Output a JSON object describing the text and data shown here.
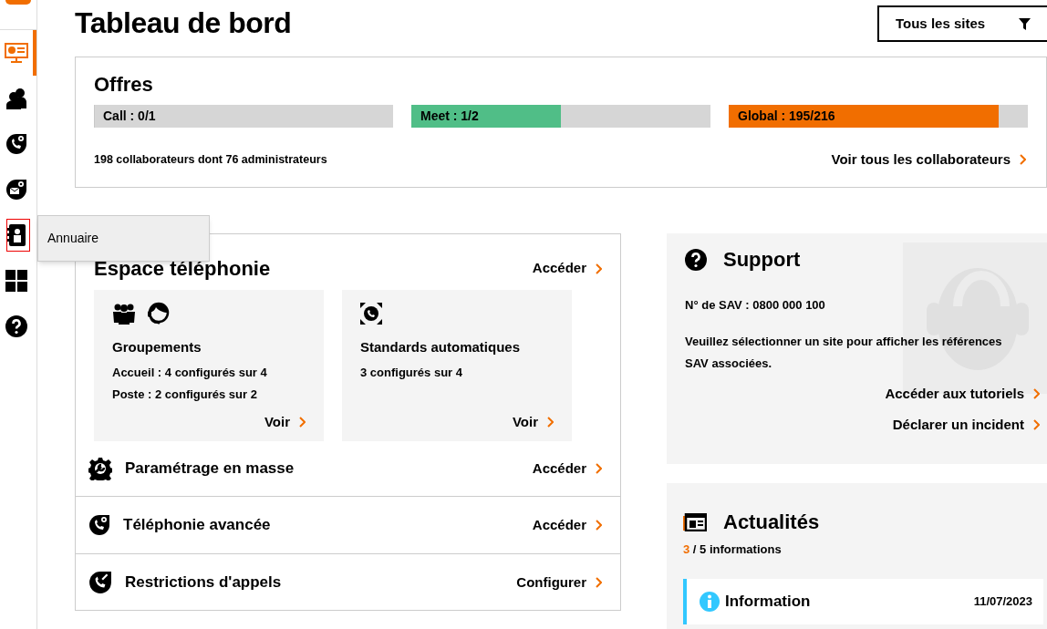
{
  "sidebar": {
    "items": [
      {
        "kind": "dashboard",
        "selected": true,
        "hovered": false
      },
      {
        "kind": "users",
        "selected": false,
        "hovered": false
      },
      {
        "kind": "phone-settings",
        "selected": false,
        "hovered": false
      },
      {
        "kind": "mail-settings",
        "selected": false,
        "hovered": false
      },
      {
        "kind": "directory",
        "selected": false,
        "hovered": true
      },
      {
        "kind": "apps",
        "selected": false,
        "hovered": false
      },
      {
        "kind": "help",
        "selected": false,
        "hovered": false
      }
    ],
    "tooltip": "Annuaire"
  },
  "page_title": "Tableau de bord",
  "site_filter": "Tous les sites",
  "offres": {
    "title": "Offres",
    "bars": [
      {
        "label": "Call : 0/1",
        "level": 0
      },
      {
        "label": "Meet : 1/2",
        "level": 0.5,
        "color": "#50be87"
      },
      {
        "label": "Global : 195/216",
        "level": 0.903,
        "color": "#f16e00"
      }
    ],
    "summary": "198 collaborateurs dont 76 administrateurs",
    "link": "Voir tous les collaborateurs"
  },
  "telephonie": {
    "title": "Espace téléphonie",
    "link": "Accéder",
    "cards": [
      {
        "kind": "groups",
        "title": "Groupements",
        "lines": [
          "Accueil : 4 configurés sur 4",
          "Poste : 2 configurés sur 2"
        ],
        "link": "Voir"
      },
      {
        "kind": "switchboard",
        "title": "Standards automatiques",
        "lines": [
          "3 configurés sur 4"
        ],
        "link": "Voir"
      }
    ],
    "rows": [
      {
        "kind": "bulk",
        "label": "Paramétrage en masse",
        "link": "Accéder"
      },
      {
        "kind": "advanced",
        "label": "Téléphonie avancée",
        "link": "Accéder"
      },
      {
        "kind": "restrictions",
        "label": "Restrictions d'appels",
        "link": "Configurer"
      }
    ]
  },
  "support": {
    "title": "Support",
    "phone": "N° de SAV : 0800 000 100",
    "message": "Veuillez sélectionner un site pour afficher les références SAV associées.",
    "links": [
      "Accéder aux tutoriels",
      "Déclarer un incident"
    ]
  },
  "actualites": {
    "title": "Actualités",
    "count": "3",
    "total": "/ 5 informations",
    "items": [
      {
        "title": "Information",
        "date": "11/07/2023"
      }
    ]
  }
}
